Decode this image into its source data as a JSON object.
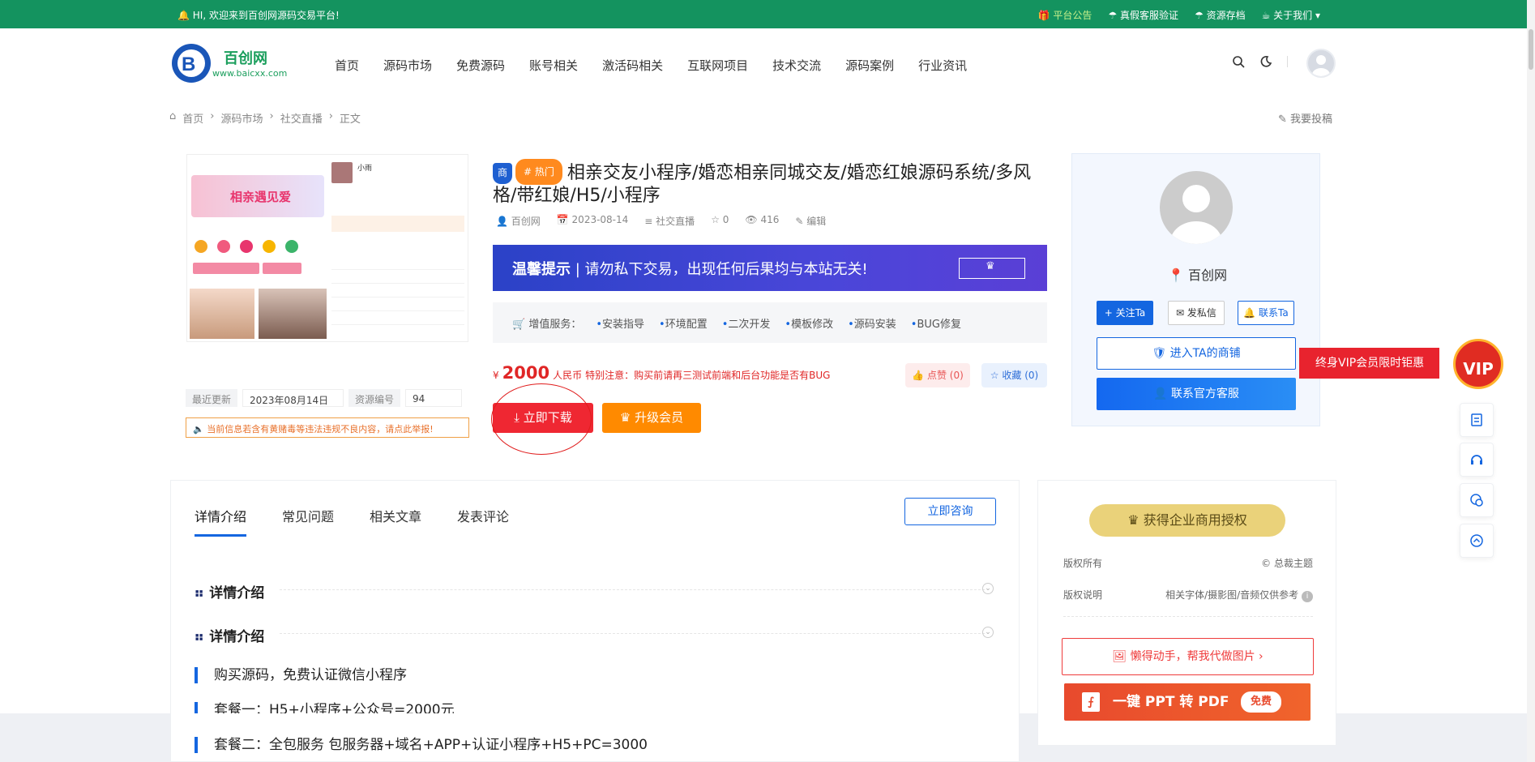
{
  "topbar": {
    "welcome": "🔔 HI, 欢迎来到百创网源码交易平台!",
    "links": [
      "🎁 平台公告",
      "☂ 真假客服验证",
      "☂ 资源存档",
      "☕ 关于我们 ▾"
    ],
    "color": "#14935f"
  },
  "header": {
    "logo_name": "百创网",
    "logo_url_text": "www.baicxx.com",
    "nav": [
      "首页",
      "源码市场",
      "免费源码",
      "账号相关",
      "激活码相关",
      "互联网项目",
      "技术交流",
      "源码案例",
      "行业资讯"
    ]
  },
  "breadcrumb": [
    "首页",
    "源码市场",
    "社交直播",
    "正文"
  ],
  "contribute": "我要投稿",
  "thumb": {
    "banner_text": "相亲遇见爱",
    "user_name": "小雨"
  },
  "resource_meta": {
    "update_label": "最近更新",
    "update_value": "2023年08月14日",
    "id_label": "资源编号",
    "id_value": "94",
    "report": "当前信息若含有黄赌毒等违法违规不良内容，请点此举报!"
  },
  "post": {
    "badge_shang": "商",
    "badge_hot": "# 热门",
    "title": "相亲交友小程序/婚恋相亲同城交友/婚恋红娘源码系统/多风格/带红娘/H5/小程序",
    "author": "百创网",
    "date": "2023-08-14",
    "category": "社交直播",
    "stars": "0",
    "views": "416",
    "edit": "编辑"
  },
  "tip": {
    "title": "温馨提示",
    "text": "请勿私下交易，出现任何后果均与本站无关!"
  },
  "service": {
    "label": "增值服务：",
    "items": [
      "安装指导",
      "环境配置",
      "二次开发",
      "模板修改",
      "源码安装",
      "BUG修复"
    ]
  },
  "price": {
    "symbol": "¥",
    "amount": "2000",
    "unit": "人民币",
    "note": "特别注意：购买前请再三测试前端和后台功能是否有BUG"
  },
  "actions": {
    "like": "点赞 (0)",
    "favorite": "收藏 (0)",
    "download": "立即下载",
    "upgrade": "升级会员"
  },
  "author": {
    "name": "百创网",
    "follow": "+ 关注Ta",
    "message": "发私信",
    "contact": "联系Ta",
    "shop": "进入TA的商铺",
    "service": "联系官方客服"
  },
  "vip": {
    "banner": "终身VIP会员限时钜惠",
    "coin": "VIP"
  },
  "article": {
    "tabs": [
      "详情介绍",
      "常见问题",
      "相关文章",
      "发表评论"
    ],
    "consult": "立即咨询",
    "section1": "详情介绍",
    "section2": "详情介绍",
    "paragraphs": [
      "购买源码，免费认证微信小程序",
      "套餐一：H5+小程序+公众号=2000元",
      "套餐二：全包服务 包服务器+域名+APP+认证小程序+H5+PC=3000"
    ]
  },
  "sidebar_card": {
    "license": "获得企业商用授权",
    "rows": [
      {
        "k": "版权所有",
        "v": "© 总裁主题"
      },
      {
        "k": "版权说明",
        "v": "相关字体/摄影图/音频仅供参考"
      }
    ],
    "ps_ad": "懒得动手，帮我代做图片",
    "pdf_ad": "一键 PPT 转 PDF",
    "pdf_free": "免费"
  }
}
